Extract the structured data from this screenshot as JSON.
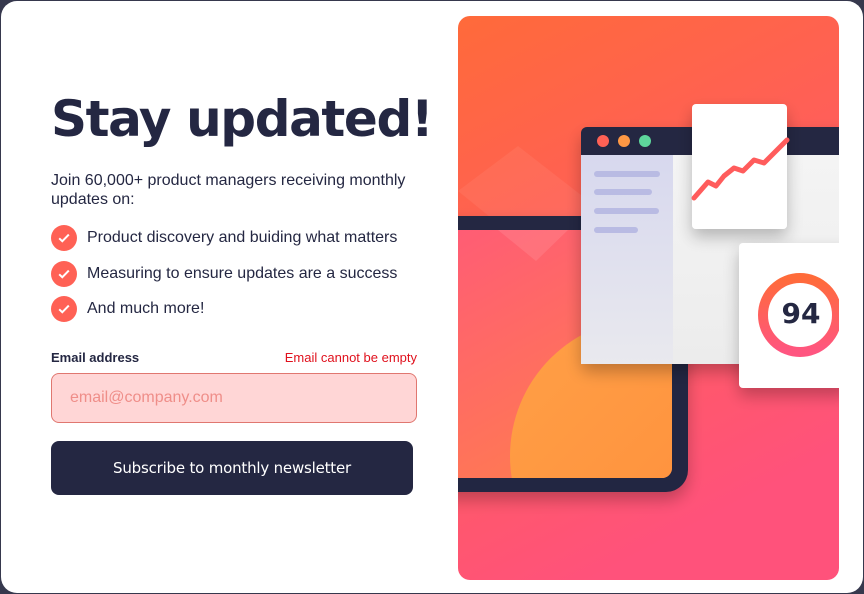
{
  "signup": {
    "title": "Stay updated!",
    "intro": "Join 60,000+ product managers receiving monthly updates on:",
    "features": [
      "Product discovery and buiding what matters",
      "Measuring to ensure updates are a success",
      "And much more!"
    ],
    "email_label": "Email address",
    "error_message": "Email cannot be empty",
    "email_value": "",
    "email_placeholder": "email@company.com",
    "submit_label": "Subscribe to monthly newsletter"
  },
  "illustration": {
    "score": "94"
  },
  "colors": {
    "accent": "#ff6155",
    "navy": "#242742",
    "error": "#e0111d",
    "input_error_bg": "#ffd6d6",
    "gradient_top": "#ff6a3a",
    "gradient_bottom": "#ff527b",
    "dot_red": "#ff6155",
    "dot_orange": "#ff9844",
    "dot_green": "#5ed69b"
  },
  "icons": {
    "check": "check-circle-icon"
  }
}
